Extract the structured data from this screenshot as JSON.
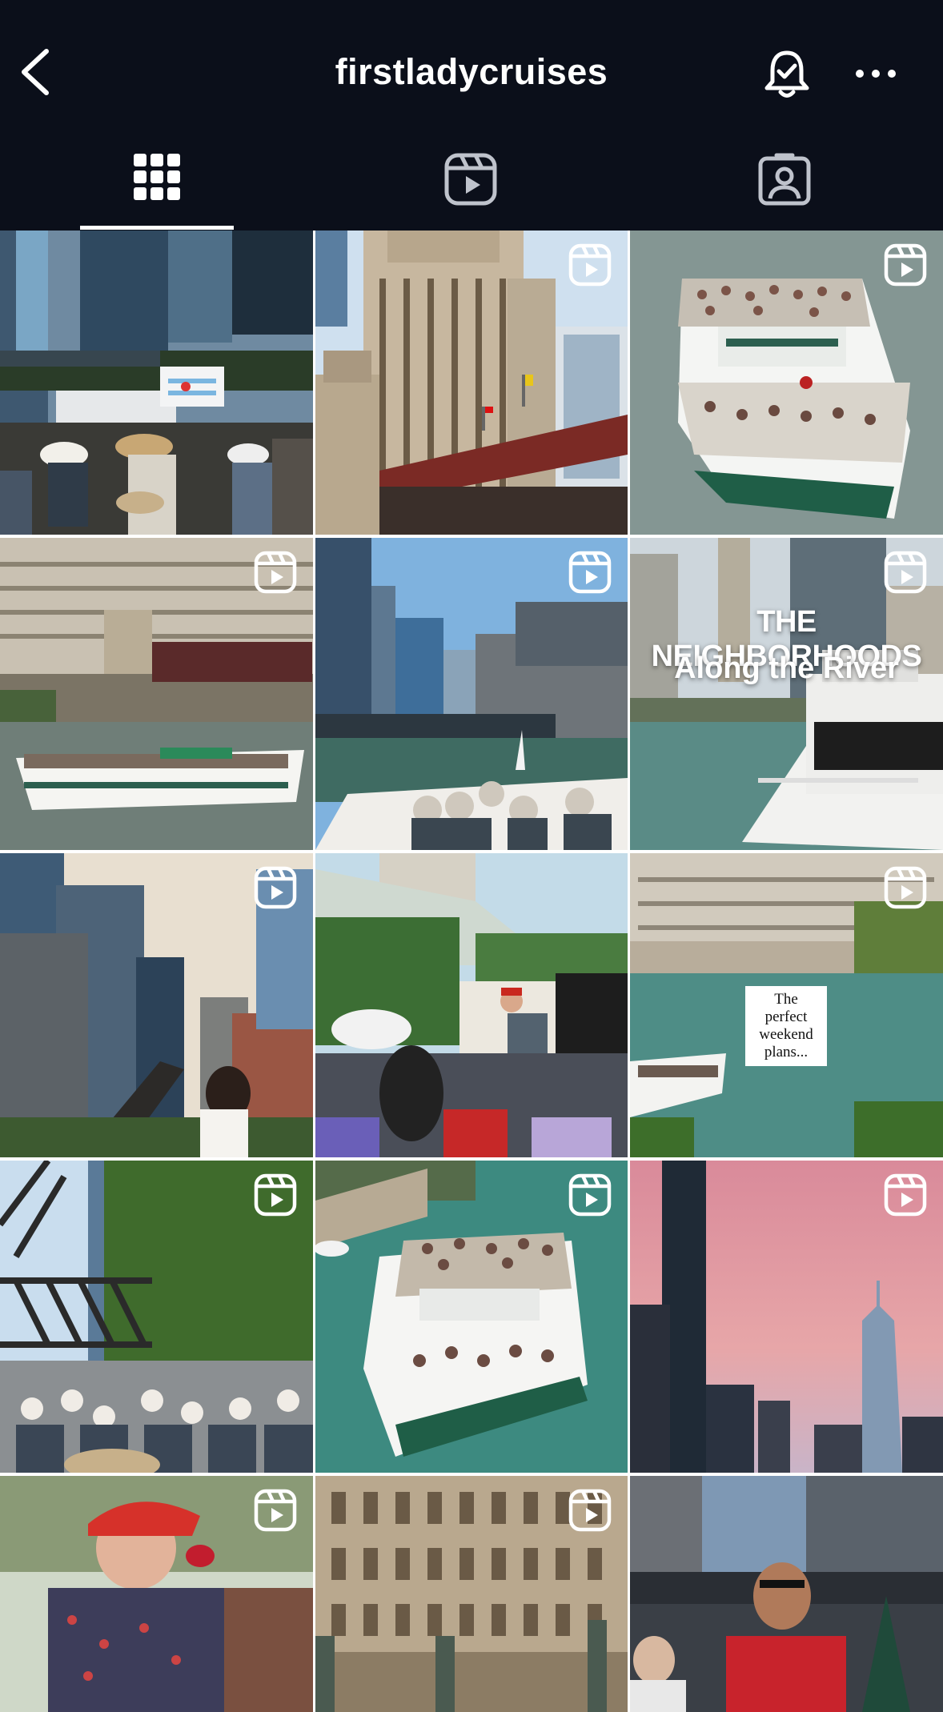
{
  "header": {
    "username": "firstladycruises",
    "icons": {
      "back": "chevron-left-icon",
      "bell": "bell-icon",
      "more": "ellipsis-icon"
    }
  },
  "tabs": [
    {
      "name": "grid",
      "icon": "grid-icon",
      "active": true
    },
    {
      "name": "reels",
      "icon": "reels-icon",
      "active": false
    },
    {
      "name": "tagged",
      "icon": "tagged-user-icon",
      "active": false
    }
  ],
  "posts": [
    {
      "kind": "photo",
      "scene": "tour group with Chicago flag"
    },
    {
      "kind": "reel",
      "scene": "Wrigley building and bridge"
    },
    {
      "kind": "reel",
      "scene": "Chicago's First Lady boat aerial"
    },
    {
      "kind": "reel",
      "scene": "boat passing Merchandise Mart"
    },
    {
      "kind": "reel",
      "scene": "river view from bow"
    },
    {
      "kind": "reel",
      "scene": "neighborhoods along river",
      "overlay": {
        "line1": "THE NEIGHBORHOODS",
        "line2": "Along the River"
      }
    },
    {
      "kind": "reel",
      "scene": "skyscrapers and passenger"
    },
    {
      "kind": "reel",
      "scene": "guide speaking to passengers"
    },
    {
      "kind": "reel",
      "scene": "weekend plans river",
      "overlay": {
        "note": "The perfect weekend plans..."
      }
    },
    {
      "kind": "reel",
      "scene": "bridge and tour group"
    },
    {
      "kind": "reel",
      "scene": "boat aerial green river"
    },
    {
      "kind": "reel",
      "scene": "sunset skyline"
    },
    {
      "kind": "reel",
      "scene": "guide with microphone"
    },
    {
      "kind": "reel",
      "scene": "building facade"
    },
    {
      "kind": "reel",
      "scene": "guide in red shirt"
    }
  ],
  "colors": {
    "background": "#0b0f1a",
    "text": "#ffffff"
  }
}
